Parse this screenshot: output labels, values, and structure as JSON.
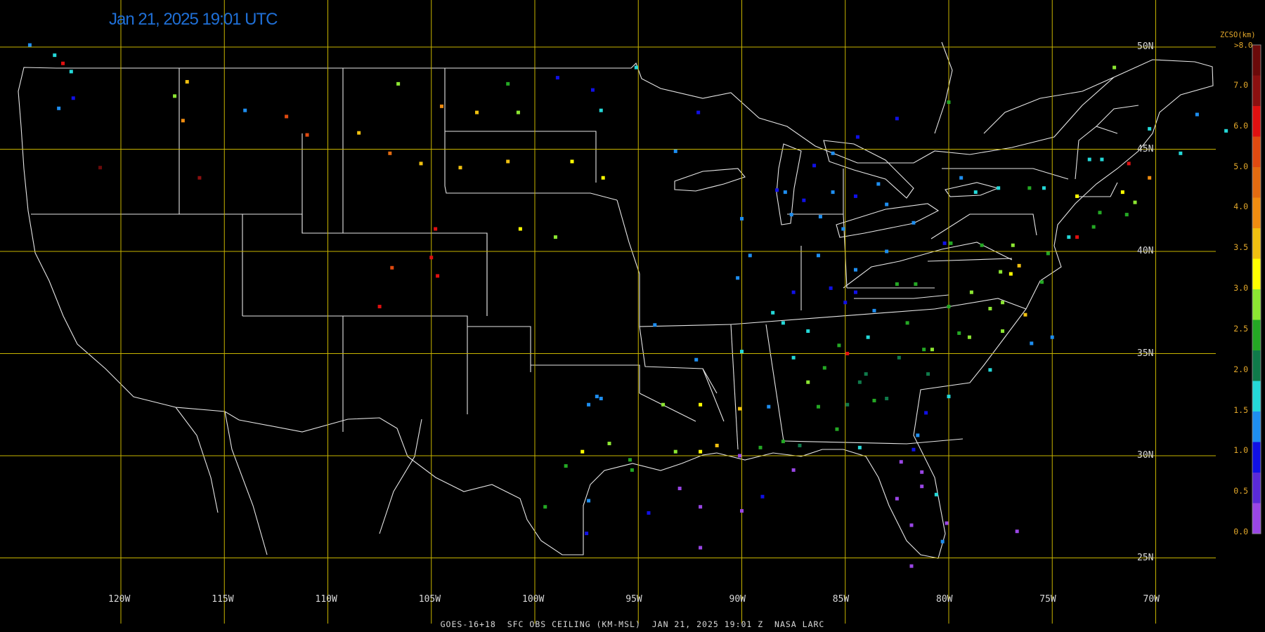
{
  "header": {
    "timestamp": "Jan 21, 2025 19:01 UTC"
  },
  "footer": {
    "caption": "GOES-16+18  SFC OBS CEILING (KM-MSL)  JAN 21, 2025 19:01 Z  NASA LARC"
  },
  "grid": {
    "latitudes": [
      "50N",
      "45N",
      "40N",
      "35N",
      "30N",
      "25N"
    ],
    "longitudes": [
      "120W",
      "115W",
      "110W",
      "105W",
      "100W",
      "95W",
      "90W",
      "85W",
      "80W",
      "75W",
      "70W"
    ],
    "grid_color": "#c8b400",
    "boundary_color": "#e6e6e6",
    "label_color": "#d8d8d8"
  },
  "colorbar": {
    "title": "ZCSO(km)",
    "top_label": ">8.0",
    "labels": [
      "7.0",
      "6.0",
      "5.0",
      "4.0",
      "3.5",
      "3.0",
      "2.5",
      "2.0",
      "1.5",
      "1.0",
      "0.5",
      "0.0"
    ],
    "colors_top_to_bottom": [
      "#6b0a0a",
      "#8b1010",
      "#e01010",
      "#e04a10",
      "#e36b10",
      "#f08c10",
      "#f0c010",
      "#ffff00",
      "#8ce632",
      "#24a824",
      "#0f7a4a",
      "#24d8d8",
      "#1e8ef0",
      "#1010e6",
      "#5a2ad8",
      "#9a46e6"
    ]
  },
  "observations": [
    {
      "lon": -124.4,
      "lat": 50.1,
      "c": "#1e8ef0"
    },
    {
      "lon": -123.2,
      "lat": 49.6,
      "c": "#24d8d8"
    },
    {
      "lon": -122.8,
      "lat": 49.2,
      "c": "#e01010"
    },
    {
      "lon": -122.4,
      "lat": 48.8,
      "c": "#24d8d8"
    },
    {
      "lon": -122.3,
      "lat": 47.5,
      "c": "#1010e6"
    },
    {
      "lon": -123.0,
      "lat": 47.0,
      "c": "#1e8ef0"
    },
    {
      "lon": -117.4,
      "lat": 47.6,
      "c": "#8ce632"
    },
    {
      "lon": -116.8,
      "lat": 48.3,
      "c": "#f0c010"
    },
    {
      "lon": -117.0,
      "lat": 46.4,
      "c": "#f08c10"
    },
    {
      "lon": -116.2,
      "lat": 43.6,
      "c": "#8b1010"
    },
    {
      "lon": -121.0,
      "lat": 44.1,
      "c": "#6b0a0a"
    },
    {
      "lon": -114.0,
      "lat": 46.9,
      "c": "#1e8ef0"
    },
    {
      "lon": -112.0,
      "lat": 46.6,
      "c": "#e04a10"
    },
    {
      "lon": -111.0,
      "lat": 45.7,
      "c": "#e04a10"
    },
    {
      "lon": -108.5,
      "lat": 45.8,
      "c": "#f0c010"
    },
    {
      "lon": -106.6,
      "lat": 48.2,
      "c": "#8ce632"
    },
    {
      "lon": -104.5,
      "lat": 47.1,
      "c": "#f08c10"
    },
    {
      "lon": -107.0,
      "lat": 44.8,
      "c": "#e36b10"
    },
    {
      "lon": -105.5,
      "lat": 44.3,
      "c": "#f0c010"
    },
    {
      "lon": -104.8,
      "lat": 41.1,
      "c": "#e01010"
    },
    {
      "lon": -105.0,
      "lat": 39.7,
      "c": "#e01010"
    },
    {
      "lon": -104.7,
      "lat": 38.8,
      "c": "#e01010"
    },
    {
      "lon": -106.9,
      "lat": 39.2,
      "c": "#e04a10"
    },
    {
      "lon": -107.5,
      "lat": 37.3,
      "c": "#e01010"
    },
    {
      "lon": -103.6,
      "lat": 44.1,
      "c": "#f0c010"
    },
    {
      "lon": -101.3,
      "lat": 44.4,
      "c": "#f0c010"
    },
    {
      "lon": -98.2,
      "lat": 44.4,
      "c": "#ffff00"
    },
    {
      "lon": -96.7,
      "lat": 43.6,
      "c": "#ffff00"
    },
    {
      "lon": -100.7,
      "lat": 41.1,
      "c": "#ffff00"
    },
    {
      "lon": -99.0,
      "lat": 40.7,
      "c": "#8ce632"
    },
    {
      "lon": -96.8,
      "lat": 46.9,
      "c": "#24d8d8"
    },
    {
      "lon": -97.2,
      "lat": 47.9,
      "c": "#1010e6"
    },
    {
      "lon": -98.9,
      "lat": 48.5,
      "c": "#1010e6"
    },
    {
      "lon": -100.8,
      "lat": 46.8,
      "c": "#8ce632"
    },
    {
      "lon": -102.8,
      "lat": 46.8,
      "c": "#f0c010"
    },
    {
      "lon": -101.3,
      "lat": 48.2,
      "c": "#24a824"
    },
    {
      "lon": -95.1,
      "lat": 49.0,
      "c": "#24d8d8"
    },
    {
      "lon": -93.2,
      "lat": 44.9,
      "c": "#1e8ef0"
    },
    {
      "lon": -92.1,
      "lat": 46.8,
      "c": "#1010e6"
    },
    {
      "lon": -90.0,
      "lat": 41.6,
      "c": "#1e8ef0"
    },
    {
      "lon": -88.3,
      "lat": 43.0,
      "c": "#1010e6"
    },
    {
      "lon": -87.9,
      "lat": 42.9,
      "c": "#1e8ef0"
    },
    {
      "lon": -87.6,
      "lat": 41.8,
      "c": "#1e8ef0"
    },
    {
      "lon": -87.0,
      "lat": 42.5,
      "c": "#1010e6"
    },
    {
      "lon": -86.5,
      "lat": 44.2,
      "c": "#1010e6"
    },
    {
      "lon": -85.6,
      "lat": 42.9,
      "c": "#1e8ef0"
    },
    {
      "lon": -84.5,
      "lat": 42.7,
      "c": "#1010e6"
    },
    {
      "lon": -83.0,
      "lat": 42.3,
      "c": "#1e8ef0"
    },
    {
      "lon": -84.4,
      "lat": 45.6,
      "c": "#1010e6"
    },
    {
      "lon": -85.6,
      "lat": 44.8,
      "c": "#1e8ef0"
    },
    {
      "lon": -83.4,
      "lat": 43.3,
      "c": "#1e8ef0"
    },
    {
      "lon": -86.2,
      "lat": 41.7,
      "c": "#1e8ef0"
    },
    {
      "lon": -85.1,
      "lat": 41.1,
      "c": "#1e8ef0"
    },
    {
      "lon": -86.3,
      "lat": 39.8,
      "c": "#1e8ef0"
    },
    {
      "lon": -87.5,
      "lat": 38.0,
      "c": "#1010e6"
    },
    {
      "lon": -89.6,
      "lat": 39.8,
      "c": "#1e8ef0"
    },
    {
      "lon": -90.2,
      "lat": 38.7,
      "c": "#1e8ef0"
    },
    {
      "lon": -88.5,
      "lat": 37.0,
      "c": "#24d8d8"
    },
    {
      "lon": -84.5,
      "lat": 39.1,
      "c": "#1e8ef0"
    },
    {
      "lon": -83.0,
      "lat": 40.0,
      "c": "#1e8ef0"
    },
    {
      "lon": -81.7,
      "lat": 41.4,
      "c": "#1e8ef0"
    },
    {
      "lon": -80.2,
      "lat": 40.4,
      "c": "#1010e6"
    },
    {
      "lon": -84.5,
      "lat": 38.0,
      "c": "#1010e6"
    },
    {
      "lon": -85.7,
      "lat": 38.2,
      "c": "#1010e6"
    },
    {
      "lon": -83.6,
      "lat": 37.1,
      "c": "#1e8ef0"
    },
    {
      "lon": -82.5,
      "lat": 38.4,
      "c": "#24a824"
    },
    {
      "lon": -86.8,
      "lat": 36.1,
      "c": "#24d8d8"
    },
    {
      "lon": -88.0,
      "lat": 36.5,
      "c": "#24d8d8"
    },
    {
      "lon": -90.0,
      "lat": 35.1,
      "c": "#24d8d8"
    },
    {
      "lon": -84.9,
      "lat": 35.0,
      "c": "#e01010"
    },
    {
      "lon": -85.3,
      "lat": 35.4,
      "c": "#24a824"
    },
    {
      "lon": -83.9,
      "lat": 35.8,
      "c": "#24d8d8"
    },
    {
      "lon": -81.2,
      "lat": 35.2,
      "c": "#24a824"
    },
    {
      "lon": -80.8,
      "lat": 35.2,
      "c": "#8ce632"
    },
    {
      "lon": -79.0,
      "lat": 35.8,
      "c": "#8ce632"
    },
    {
      "lon": -77.4,
      "lat": 36.1,
      "c": "#8ce632"
    },
    {
      "lon": -78.0,
      "lat": 34.2,
      "c": "#24d8d8"
    },
    {
      "lon": -76.0,
      "lat": 35.5,
      "c": "#1e8ef0"
    },
    {
      "lon": -77.4,
      "lat": 37.5,
      "c": "#8ce632"
    },
    {
      "lon": -76.3,
      "lat": 36.9,
      "c": "#f0c010"
    },
    {
      "lon": -77.0,
      "lat": 38.9,
      "c": "#ffff00"
    },
    {
      "lon": -76.6,
      "lat": 39.3,
      "c": "#f0c010"
    },
    {
      "lon": -77.5,
      "lat": 39.0,
      "c": "#8ce632"
    },
    {
      "lon": -78.9,
      "lat": 38.0,
      "c": "#8ce632"
    },
    {
      "lon": -80.0,
      "lat": 37.3,
      "c": "#24a824"
    },
    {
      "lon": -81.6,
      "lat": 38.4,
      "c": "#24a824"
    },
    {
      "lon": -79.9,
      "lat": 40.4,
      "c": "#24a824"
    },
    {
      "lon": -78.4,
      "lat": 40.3,
      "c": "#24a824"
    },
    {
      "lon": -76.9,
      "lat": 40.3,
      "c": "#8ce632"
    },
    {
      "lon": -75.2,
      "lat": 39.9,
      "c": "#24a824"
    },
    {
      "lon": -74.2,
      "lat": 40.7,
      "c": "#24d8d8"
    },
    {
      "lon": -73.8,
      "lat": 40.7,
      "c": "#e01010"
    },
    {
      "lon": -73.0,
      "lat": 41.2,
      "c": "#24a824"
    },
    {
      "lon": -72.7,
      "lat": 41.9,
      "c": "#24a824"
    },
    {
      "lon": -71.4,
      "lat": 41.8,
      "c": "#24a824"
    },
    {
      "lon": -71.0,
      "lat": 42.4,
      "c": "#8ce632"
    },
    {
      "lon": -71.6,
      "lat": 42.9,
      "c": "#ffff00"
    },
    {
      "lon": -70.3,
      "lat": 43.6,
      "c": "#f08c10"
    },
    {
      "lon": -71.3,
      "lat": 44.3,
      "c": "#e01010"
    },
    {
      "lon": -72.6,
      "lat": 44.5,
      "c": "#24d8d8"
    },
    {
      "lon": -73.2,
      "lat": 44.5,
      "c": "#24d8d8"
    },
    {
      "lon": -73.8,
      "lat": 42.7,
      "c": "#ffff00"
    },
    {
      "lon": -75.4,
      "lat": 43.1,
      "c": "#24d8d8"
    },
    {
      "lon": -76.1,
      "lat": 43.1,
      "c": "#24a824"
    },
    {
      "lon": -77.6,
      "lat": 43.1,
      "c": "#24d8d8"
    },
    {
      "lon": -78.7,
      "lat": 42.9,
      "c": "#24d8d8"
    },
    {
      "lon": -79.4,
      "lat": 43.6,
      "c": "#1e8ef0"
    },
    {
      "lon": -68.8,
      "lat": 44.8,
      "c": "#24d8d8"
    },
    {
      "lon": -68.0,
      "lat": 46.7,
      "c": "#1e8ef0"
    },
    {
      "lon": -70.3,
      "lat": 46.0,
      "c": "#24d8d8"
    },
    {
      "lon": -66.6,
      "lat": 45.9,
      "c": "#24d8d8"
    },
    {
      "lon": -65.0,
      "lat": 44.5,
      "c": "#1e8ef0"
    },
    {
      "lon": -63.5,
      "lat": 44.8,
      "c": "#f08c10"
    },
    {
      "lon": -72.0,
      "lat": 49.0,
      "c": "#8ce632"
    },
    {
      "lon": -82.5,
      "lat": 46.5,
      "c": "#1010e6"
    },
    {
      "lon": -80.0,
      "lat": 47.3,
      "c": "#24a824"
    },
    {
      "lon": -84.3,
      "lat": 33.6,
      "c": "#0f7a4a"
    },
    {
      "lon": -83.0,
      "lat": 32.8,
      "c": "#0f7a4a"
    },
    {
      "lon": -81.1,
      "lat": 32.1,
      "c": "#1010e6"
    },
    {
      "lon": -80.0,
      "lat": 32.9,
      "c": "#24d8d8"
    },
    {
      "lon": -81.0,
      "lat": 34.0,
      "c": "#0f7a4a"
    },
    {
      "lon": -82.4,
      "lat": 34.8,
      "c": "#0f7a4a"
    },
    {
      "lon": -84.9,
      "lat": 32.5,
      "c": "#0f7a4a"
    },
    {
      "lon": -86.8,
      "lat": 33.6,
      "c": "#8ce632"
    },
    {
      "lon": -86.3,
      "lat": 32.4,
      "c": "#24a824"
    },
    {
      "lon": -88.0,
      "lat": 30.7,
      "c": "#24a824"
    },
    {
      "lon": -85.4,
      "lat": 31.3,
      "c": "#24a824"
    },
    {
      "lon": -84.3,
      "lat": 30.4,
      "c": "#24d8d8"
    },
    {
      "lon": -81.7,
      "lat": 30.3,
      "c": "#1010e6"
    },
    {
      "lon": -81.3,
      "lat": 29.2,
      "c": "#9a46e6"
    },
    {
      "lon": -82.3,
      "lat": 29.7,
      "c": "#9a46e6"
    },
    {
      "lon": -81.3,
      "lat": 28.5,
      "c": "#9a46e6"
    },
    {
      "lon": -82.5,
      "lat": 27.9,
      "c": "#9a46e6"
    },
    {
      "lon": -80.6,
      "lat": 28.1,
      "c": "#24d8d8"
    },
    {
      "lon": -80.1,
      "lat": 26.7,
      "c": "#9a46e6"
    },
    {
      "lon": -81.8,
      "lat": 26.6,
      "c": "#9a46e6"
    },
    {
      "lon": -80.3,
      "lat": 25.8,
      "c": "#1e8ef0"
    },
    {
      "lon": -81.8,
      "lat": 24.6,
      "c": "#9a46e6"
    },
    {
      "lon": -87.2,
      "lat": 30.5,
      "c": "#0f7a4a"
    },
    {
      "lon": -89.1,
      "lat": 30.4,
      "c": "#24a824"
    },
    {
      "lon": -90.1,
      "lat": 30.0,
      "c": "#9a46e6"
    },
    {
      "lon": -91.2,
      "lat": 30.5,
      "c": "#f0c010"
    },
    {
      "lon": -92.0,
      "lat": 30.2,
      "c": "#ffff00"
    },
    {
      "lon": -93.2,
      "lat": 30.2,
      "c": "#8ce632"
    },
    {
      "lon": -90.1,
      "lat": 32.3,
      "c": "#f0c010"
    },
    {
      "lon": -88.7,
      "lat": 32.4,
      "c": "#1e8ef0"
    },
    {
      "lon": -92.0,
      "lat": 32.5,
      "c": "#ffff00"
    },
    {
      "lon": -93.8,
      "lat": 32.5,
      "c": "#8ce632"
    },
    {
      "lon": -92.2,
      "lat": 34.7,
      "c": "#1e8ef0"
    },
    {
      "lon": -94.2,
      "lat": 36.4,
      "c": "#1e8ef0"
    },
    {
      "lon": -95.4,
      "lat": 29.8,
      "c": "#24a824"
    },
    {
      "lon": -95.3,
      "lat": 29.3,
      "c": "#24a824"
    },
    {
      "lon": -96.4,
      "lat": 30.6,
      "c": "#8ce632"
    },
    {
      "lon": -97.7,
      "lat": 30.2,
      "c": "#ffff00"
    },
    {
      "lon": -98.5,
      "lat": 29.5,
      "c": "#24a824"
    },
    {
      "lon": -97.4,
      "lat": 27.8,
      "c": "#1e8ef0"
    },
    {
      "lon": -97.5,
      "lat": 26.2,
      "c": "#1010e6"
    },
    {
      "lon": -99.5,
      "lat": 27.5,
      "c": "#24a824"
    },
    {
      "lon": -97.0,
      "lat": 32.9,
      "c": "#1e8ef0"
    },
    {
      "lon": -96.8,
      "lat": 32.8,
      "c": "#1e8ef0"
    },
    {
      "lon": -97.4,
      "lat": 32.5,
      "c": "#1e8ef0"
    },
    {
      "lon": -93.0,
      "lat": 28.4,
      "c": "#9a46e6"
    },
    {
      "lon": -92.0,
      "lat": 27.5,
      "c": "#9a46e6"
    },
    {
      "lon": -94.5,
      "lat": 27.2,
      "c": "#1010e6"
    },
    {
      "lon": -90.0,
      "lat": 27.3,
      "c": "#9a46e6"
    },
    {
      "lon": -89.0,
      "lat": 28.0,
      "c": "#1010e6"
    },
    {
      "lon": -87.5,
      "lat": 29.3,
      "c": "#9a46e6"
    },
    {
      "lon": -92.0,
      "lat": 25.5,
      "c": "#9a46e6"
    },
    {
      "lon": -76.7,
      "lat": 26.3,
      "c": "#9a46e6"
    },
    {
      "lon": -81.5,
      "lat": 31.0,
      "c": "#1e8ef0"
    },
    {
      "lon": -83.6,
      "lat": 32.7,
      "c": "#24a824"
    },
    {
      "lon": -84.0,
      "lat": 34.0,
      "c": "#0f7a4a"
    },
    {
      "lon": -86.0,
      "lat": 34.3,
      "c": "#24a824"
    },
    {
      "lon": -87.5,
      "lat": 34.8,
      "c": "#24d8d8"
    },
    {
      "lon": -85.0,
      "lat": 37.5,
      "c": "#1010e6"
    },
    {
      "lon": -82.0,
      "lat": 36.5,
      "c": "#24a824"
    },
    {
      "lon": -79.5,
      "lat": 36.0,
      "c": "#24a824"
    },
    {
      "lon": -78.0,
      "lat": 37.2,
      "c": "#8ce632"
    },
    {
      "lon": -75.5,
      "lat": 38.5,
      "c": "#24a824"
    },
    {
      "lon": -75.0,
      "lat": 35.8,
      "c": "#1e8ef0"
    }
  ]
}
